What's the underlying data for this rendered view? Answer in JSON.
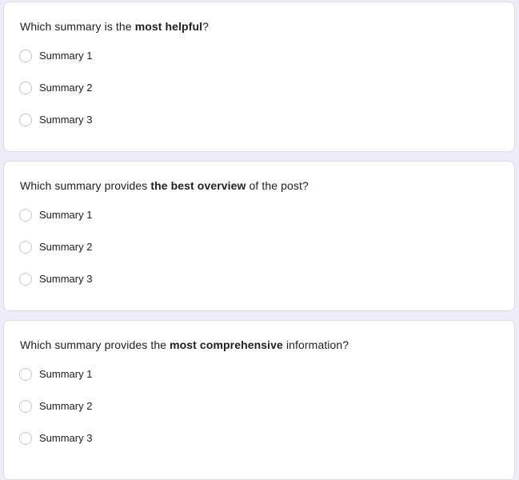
{
  "questions": [
    {
      "text_before": "Which summary is the ",
      "text_bold": "most helpful",
      "text_after": "?",
      "options": [
        "Summary 1",
        "Summary 2",
        "Summary 3"
      ]
    },
    {
      "text_before": "Which summary provides ",
      "text_bold": "the best overview",
      "text_after": " of the post?",
      "options": [
        "Summary 1",
        "Summary 2",
        "Summary 3"
      ]
    },
    {
      "text_before": "Which summary provides the ",
      "text_bold": "most comprehensive",
      "text_after": " information?",
      "options": [
        "Summary 1",
        "Summary 2",
        "Summary 3"
      ]
    }
  ],
  "colors": {
    "page_background": "#efebf9",
    "card_background": "#ffffff",
    "card_border": "#dadce0",
    "radio_border": "#c4c7c5",
    "text": "#202124"
  }
}
